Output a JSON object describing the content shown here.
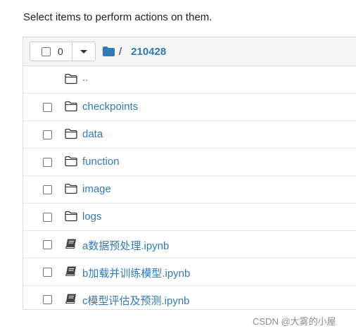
{
  "instructions": "Select items to perform actions on them.",
  "header": {
    "selected_count": "0",
    "separator": "/",
    "current_folder": "210428"
  },
  "items": [
    {
      "name": "..",
      "type": "parent"
    },
    {
      "name": "checkpoints",
      "type": "folder"
    },
    {
      "name": "data",
      "type": "folder"
    },
    {
      "name": "function",
      "type": "folder"
    },
    {
      "name": "image",
      "type": "folder"
    },
    {
      "name": "logs",
      "type": "folder"
    },
    {
      "name": "a数据预处理.ipynb",
      "type": "notebook"
    },
    {
      "name": "b加载并训练模型.ipynb",
      "type": "notebook"
    },
    {
      "name": "c模型评估及预测.ipynb",
      "type": "notebook"
    }
  ],
  "watermark": "CSDN @大雾的小屋",
  "colors": {
    "link": "#337ab7",
    "header_bg": "#f5f5f5",
    "border": "#dddddd"
  }
}
